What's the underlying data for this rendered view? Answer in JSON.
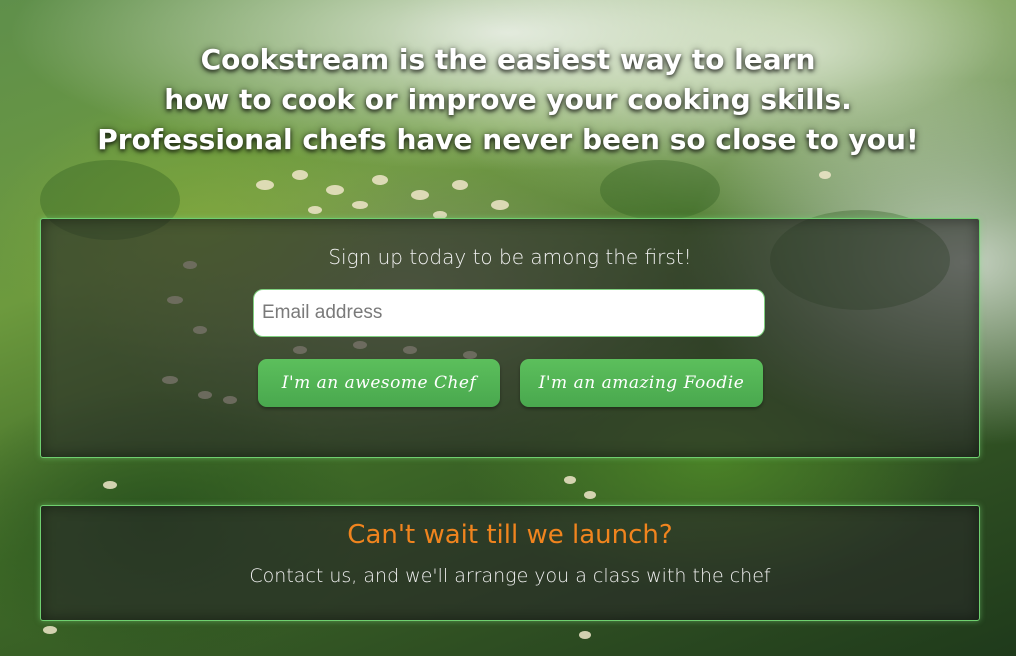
{
  "hero": {
    "line1": "Cookstream is the easiest way to learn",
    "line2": "how to cook or improve your cooking skills.",
    "line3": "Professional chefs have never been so close to you!"
  },
  "signup": {
    "prompt": "Sign up today to be among the first!",
    "email_placeholder": "Email address",
    "email_value": "",
    "chef_button_label": "I'm an awesome Chef",
    "foodie_button_label": "I'm an amazing Foodie"
  },
  "contact": {
    "title": "Can't wait till we launch?",
    "text": "Contact us, and we'll arrange you a class with the chef"
  },
  "colors": {
    "accent_green": "#4caf50",
    "panel_border": "#6fcf6f",
    "contact_title": "#f0841e"
  }
}
